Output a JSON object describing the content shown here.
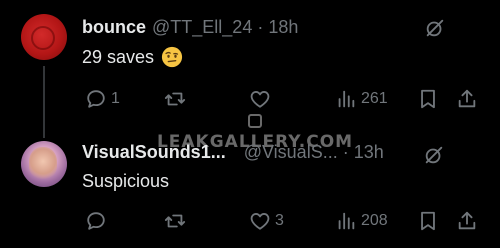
{
  "posts": [
    {
      "name": "bounce",
      "handle": "@TT_Ell_24",
      "separator": "·",
      "time": "18h",
      "text": "29 saves",
      "emoji": "face-with-raised-eyebrow",
      "actions": {
        "replies": "1",
        "reposts": "",
        "likes": "",
        "views": "261"
      }
    },
    {
      "name": "VisualSounds1...",
      "handle": "@VisualS...",
      "separator": "·",
      "time": "13h",
      "text": "Suspicious",
      "actions": {
        "replies": "",
        "reposts": "",
        "likes": "3",
        "views": "208"
      }
    }
  ],
  "watermark": "LEAKGALLERY.COM",
  "colors": {
    "background": "#000000",
    "text": "#e7e9ea",
    "muted": "#71767b",
    "divider": "#333639"
  }
}
